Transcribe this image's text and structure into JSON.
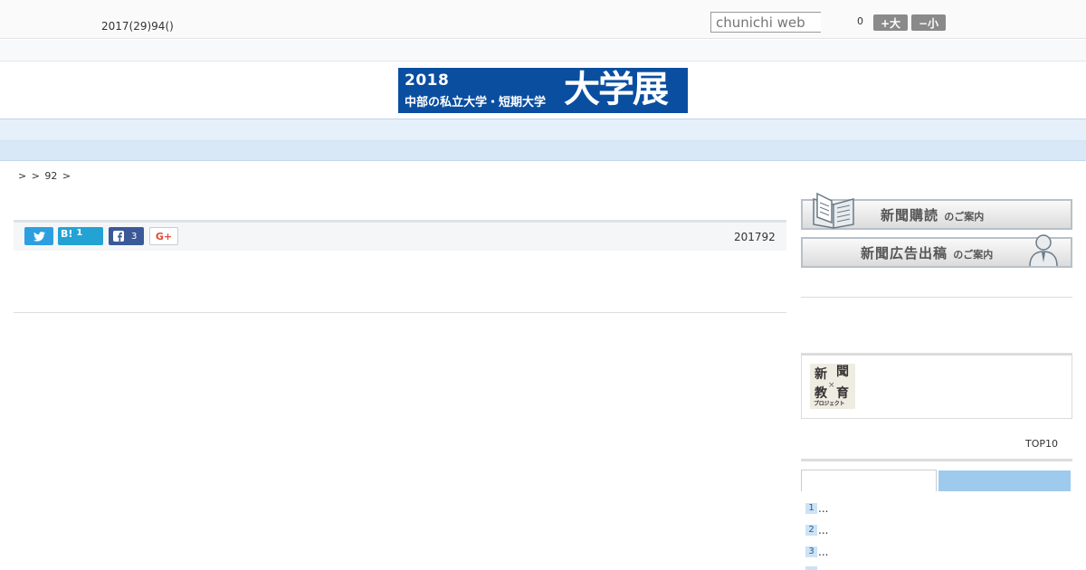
{
  "header": {
    "date": "2017(29)94()",
    "search_placeholder": "chunichi web",
    "font_size_value": "0",
    "font_up_label": "+大",
    "font_down_label": "−小"
  },
  "banner": {
    "year": "2018",
    "subtitle": "中部の私立大学・短期大学",
    "title": "大学展"
  },
  "nav": {
    "items": [
      {
        "label": "　　"
      },
      {
        "label": "　　"
      },
      {
        "label": "　　"
      },
      {
        "label": "　　"
      },
      {
        "label": "　　"
      },
      {
        "label": "　　"
      },
      {
        "label": "　　"
      },
      {
        "label": "　　"
      },
      {
        "label": "　　"
      }
    ]
  },
  "breadcrumb": ">  > 92 >",
  "share": {
    "twitter_count": "",
    "hatena_label": "B!",
    "hatena_count": "1",
    "facebook_count": "3",
    "gplus_label": "G+",
    "pub_date": "201792"
  },
  "sidebar": {
    "subscribe": {
      "title": "新聞購読",
      "suffix": "のご案内"
    },
    "advertise": {
      "title": "新聞広告出稿",
      "suffix": "のご案内"
    },
    "edu_logo": {
      "c1": "新",
      "c2": "聞",
      "x": "×",
      "c3": "教",
      "c4": "育",
      "tiny": "プロジェクト"
    },
    "top10_label": "TOP10",
    "ranking": [
      {
        "num": "1",
        "text": "..."
      },
      {
        "num": "2",
        "text": "..."
      },
      {
        "num": "3",
        "text": "..."
      },
      {
        "num": "",
        "text": ""
      }
    ]
  },
  "colors": {
    "banner": "#0a4ea0",
    "nav_bg": "#e6f0fa",
    "twitter": "#2d9fe0",
    "hatena": "#23a2d4",
    "facebook": "#3b5998",
    "tab_active": "#9ecaee"
  }
}
